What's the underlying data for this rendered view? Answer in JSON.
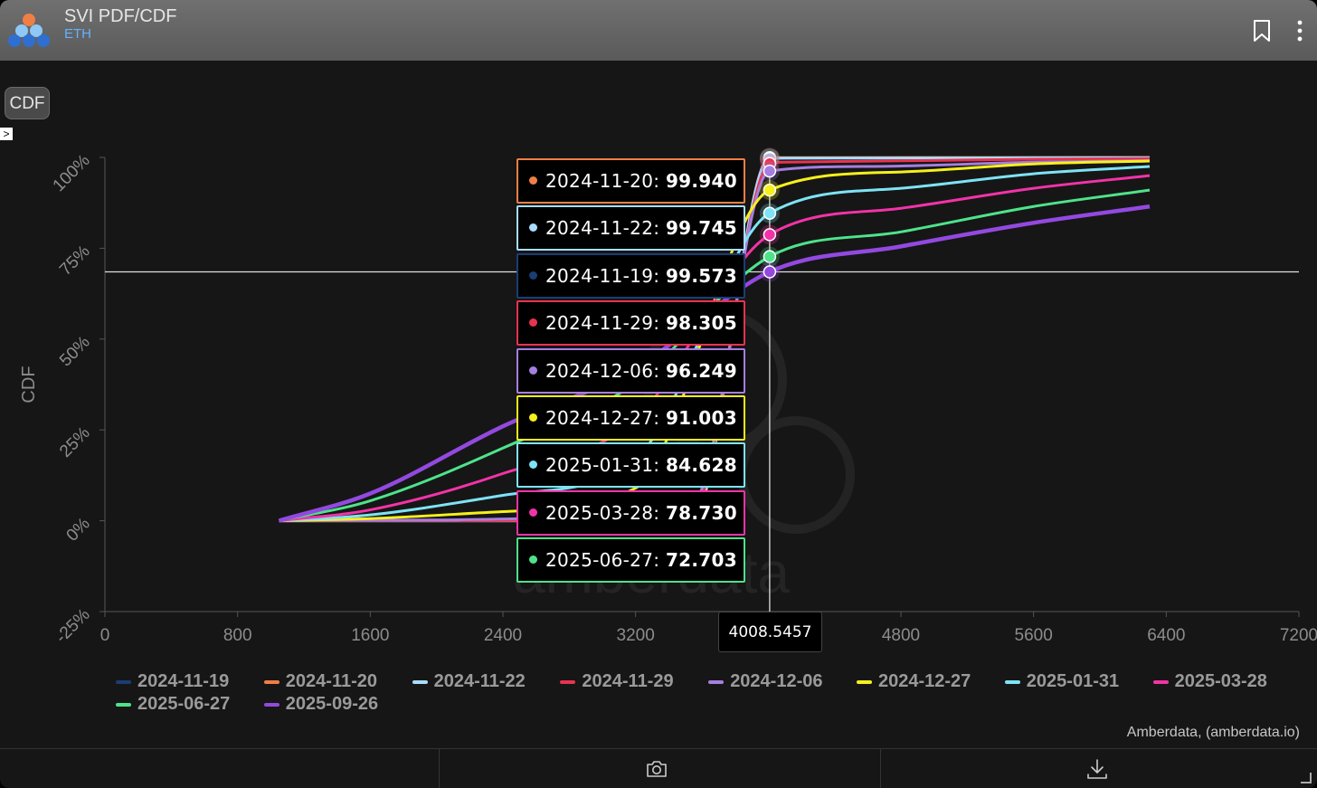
{
  "header": {
    "title": "SVI PDF/CDF",
    "subtitle": "ETH",
    "bookmark_icon": "bookmark-icon",
    "menu_icon": "more-vertical-icon"
  },
  "controls": {
    "mode_button": "CDF",
    "expand_label": ">"
  },
  "credit": "Amberdata, (amberdata.io)",
  "footer": {
    "camera_icon": "camera-icon",
    "download_icon": "download-icon"
  },
  "chart_data": {
    "type": "line",
    "title": "",
    "xlabel": "",
    "ylabel": "CDF",
    "xlim": [
      0,
      7200
    ],
    "ylim": [
      -25,
      100
    ],
    "x_ticks": [
      "0",
      "800",
      "1600",
      "2400",
      "3200",
      "4000",
      "4800",
      "5600",
      "6400",
      "7200"
    ],
    "y_ticks": [
      "-25%",
      "0%",
      "25%",
      "50%",
      "75%",
      "100%"
    ],
    "grid": false,
    "crosshair": {
      "x_label": "4008.5457",
      "x": 4008.5457,
      "y": 68.5
    },
    "tooltip": [
      {
        "name": "2024-11-20",
        "value": "99.940",
        "color": "#f07f45"
      },
      {
        "name": "2024-11-22",
        "value": "99.745",
        "color": "#a9dcff"
      },
      {
        "name": "2024-11-19",
        "value": "99.573",
        "color": "#1a3e73"
      },
      {
        "name": "2024-11-29",
        "value": "98.305",
        "color": "#e8334f"
      },
      {
        "name": "2024-12-06",
        "value": "96.249",
        "color": "#a57fe0"
      },
      {
        "name": "2024-12-27",
        "value": "91.003",
        "color": "#f6f01c"
      },
      {
        "name": "2025-01-31",
        "value": "84.628",
        "color": "#7ee3f5"
      },
      {
        "name": "2025-03-28",
        "value": "78.730",
        "color": "#f233a8"
      },
      {
        "name": "2025-06-27",
        "value": "72.703",
        "color": "#4ee38b"
      }
    ],
    "series": [
      {
        "name": "2024-11-19",
        "color": "#1a3e73",
        "x": [
          1050,
          2400,
          3200,
          3550,
          4008,
          4100,
          5600,
          6300
        ],
        "y": [
          0,
          0,
          0.05,
          1,
          99.573,
          99.7,
          99.9,
          99.95
        ]
      },
      {
        "name": "2024-11-20",
        "color": "#f07f45",
        "x": [
          1050,
          2400,
          3200,
          3550,
          4008,
          4100,
          5600,
          6300
        ],
        "y": [
          0,
          0,
          0.03,
          0.8,
          99.94,
          99.95,
          99.97,
          99.98
        ]
      },
      {
        "name": "2024-11-22",
        "color": "#a9dcff",
        "x": [
          1050,
          2400,
          3200,
          3550,
          4008,
          4100,
          5600,
          6300
        ],
        "y": [
          0,
          0,
          0.08,
          1.3,
          99.745,
          99.8,
          99.9,
          99.95
        ]
      },
      {
        "name": "2024-11-29",
        "color": "#e8334f",
        "x": [
          1050,
          2400,
          3000,
          3550,
          4008,
          4100,
          5600,
          6300
        ],
        "y": [
          0,
          0.05,
          0.3,
          3,
          98.305,
          98.7,
          99.5,
          99.7
        ]
      },
      {
        "name": "2024-12-06",
        "color": "#a57fe0",
        "x": [
          1050,
          2000,
          3000,
          3550,
          4008,
          4600,
          5600,
          6300
        ],
        "y": [
          0,
          0.2,
          1,
          5,
          96.249,
          97.5,
          98.7,
          99.1
        ]
      },
      {
        "name": "2024-12-27",
        "color": "#f6f01c",
        "x": [
          1050,
          1600,
          2400,
          3200,
          4008,
          4800,
          5600,
          6300
        ],
        "y": [
          0,
          0.6,
          2.5,
          9,
          91.003,
          96,
          98.2,
          99.0
        ]
      },
      {
        "name": "2025-01-31",
        "color": "#7ee3f5",
        "x": [
          1050,
          1600,
          2400,
          3200,
          4008,
          4800,
          5600,
          6300
        ],
        "y": [
          0,
          1.6,
          7,
          17,
          84.628,
          91.5,
          95.5,
          97.5
        ]
      },
      {
        "name": "2025-03-28",
        "color": "#f233a8",
        "x": [
          1050,
          1600,
          2400,
          3200,
          4008,
          4800,
          5600,
          6300
        ],
        "y": [
          0,
          3,
          13,
          28,
          78.73,
          86,
          91.5,
          95.0
        ]
      },
      {
        "name": "2025-06-27",
        "color": "#4ee38b",
        "x": [
          1050,
          1600,
          2400,
          3200,
          4008,
          4800,
          5600,
          6300
        ],
        "y": [
          0,
          5.5,
          20,
          38,
          72.703,
          79.5,
          86.5,
          91.0
        ]
      },
      {
        "name": "2025-09-26",
        "color": "#9349e0",
        "x": [
          1050,
          1600,
          2400,
          3200,
          4008,
          4800,
          5600,
          6300
        ],
        "y": [
          0,
          7.5,
          26,
          42,
          68.5,
          75.5,
          82,
          86.5
        ]
      }
    ],
    "legend": [
      "2024-11-19",
      "2024-11-20",
      "2024-11-22",
      "2024-11-29",
      "2024-12-06",
      "2024-12-27",
      "2025-01-31",
      "2025-03-28",
      "2025-06-27",
      "2025-09-26"
    ],
    "legend_position": "bottom"
  }
}
